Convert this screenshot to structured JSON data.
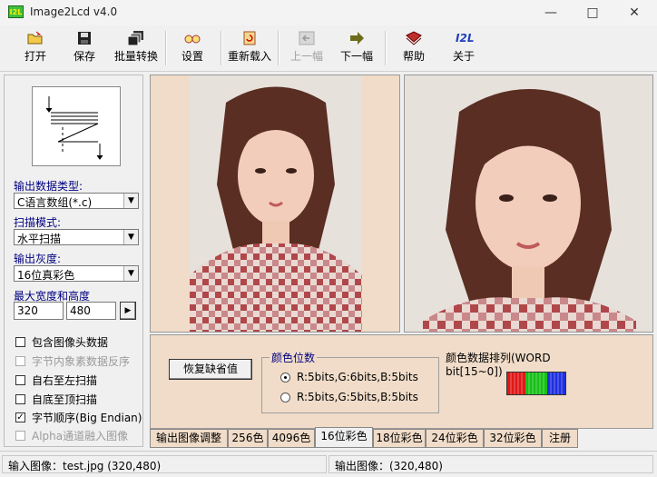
{
  "window": {
    "title": "Image2Lcd v4.0",
    "icon_text": "I2L"
  },
  "toolbar": {
    "items": [
      {
        "label": "打开",
        "icon": "open-folder-icon"
      },
      {
        "label": "保存",
        "icon": "save-disk-icon"
      },
      {
        "label": "批量转换",
        "icon": "batch-convert-icon"
      },
      {
        "label": "设置",
        "icon": "settings-glasses-icon"
      },
      {
        "label": "重新载入",
        "icon": "reload-icon"
      },
      {
        "label": "上一幅",
        "icon": "previous-icon",
        "disabled": true
      },
      {
        "label": "下一幅",
        "icon": "next-arrow-icon"
      },
      {
        "label": "帮助",
        "icon": "help-book-icon"
      },
      {
        "label": "关于",
        "icon": "about-i2l-icon",
        "icon_text": "I2L"
      }
    ]
  },
  "left_panel": {
    "output_type_label": "输出数据类型:",
    "output_type_value": "C语言数组(*.c)",
    "scan_mode_label": "扫描模式:",
    "scan_mode_value": "水平扫描",
    "gray_label": "输出灰度:",
    "gray_value": "16位真彩色",
    "max_size_label": "最大宽度和高度",
    "max_width": "320",
    "max_height": "480",
    "checkboxes": [
      {
        "label": "包含图像头数据",
        "checked": false,
        "disabled": false
      },
      {
        "label": "字节内象素数据反序",
        "checked": false,
        "disabled": true
      },
      {
        "label": "自右至左扫描",
        "checked": false,
        "disabled": false
      },
      {
        "label": "自底至顶扫描",
        "checked": false,
        "disabled": false
      },
      {
        "label": "字节顺序(Big Endian)",
        "checked": true,
        "disabled": false
      },
      {
        "label": "Alpha通道融入图像",
        "checked": false,
        "disabled": true
      }
    ]
  },
  "color_page": {
    "restore_button": "恢复缺省值",
    "bits_group_title": "颜色位数",
    "radio_options": [
      {
        "label": "R:5bits,G:6bits,B:5bits",
        "selected": true
      },
      {
        "label": "R:5bits,G:5bits,B:5bits",
        "selected": false
      }
    ],
    "order_group_title": "颜色数据排列(WORD bit[15~0])"
  },
  "tabs": [
    {
      "label": "输出图像调整",
      "active": false
    },
    {
      "label": "256色",
      "active": false
    },
    {
      "label": "4096色",
      "active": false
    },
    {
      "label": "16位彩色",
      "active": true
    },
    {
      "label": "18位彩色",
      "active": false
    },
    {
      "label": "24位彩色",
      "active": false
    },
    {
      "label": "32位彩色",
      "active": false
    },
    {
      "label": "注册",
      "active": false
    }
  ],
  "status": {
    "input": "输入图像：test.jpg (320,480)",
    "output": "输出图像：(320,480)"
  }
}
